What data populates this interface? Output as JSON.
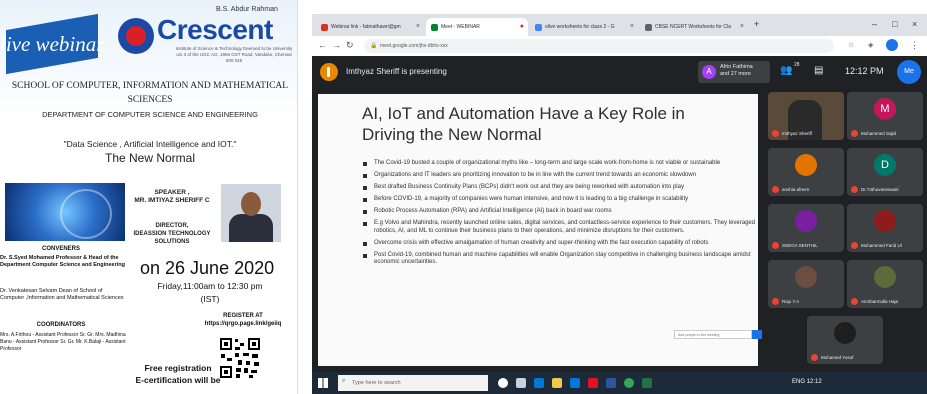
{
  "poster": {
    "live_badge": "live webinar",
    "logo_top": "B.S. Abdur Rahman",
    "logo_name": "Crescent",
    "logo_sub": "Institute of Science & Technology Deemed to be University u/s 3 of the UGC Act, 1956 GST Road, Vandalur, Chennai 600 048",
    "school": "SCHOOL OF COMPUTER, INFORMATION AND MATHEMATICAL SCIENCES",
    "department": "DEPARTMENT OF COMPUTER SCIENCE AND ENGINEERING",
    "topic": "\"Data Science , Artificial Intelligence and IOT.\"",
    "subtitle": "The New Normal",
    "speaker_heading": "SPEAKER ,",
    "speaker_name": "MR. IMTIYAZ SHERIFF C",
    "speaker_role": "DIRECTOR,",
    "speaker_company": "IDEASSION TECHNOLOGY SOLUTIONS",
    "conveners_title": "CONVENERS",
    "convener_1": "Dr. S.Syed Mohamed Professor & Head of the Department Computer Science and Engineering",
    "convener_2": "Dr. Venkatesan Selvam Dean of School of Computer ,Information and Mathematical Sciences",
    "coordinators_title": "COORDINATORS",
    "coordinators": "Mrs. A.Firthou - Assistant Professor Sr. Gr. Mrs. Madhina Banu - Assistant Professor Sr. Gr. Mr. K.Balaji - Assistant Professor",
    "date": "on 26 June 2020",
    "time_line": "Friday,11:00am to 12:30 pm",
    "timezone": "(IST)",
    "register_title": "REGISTER AT",
    "register_url": "https://qrgo.page.link/geiiq",
    "free_registration": "Free registration",
    "ecert": "E-certification will be"
  },
  "browser": {
    "tabs": [
      {
        "label": "Webinar link - fatmathawri@gm",
        "color": "#d93025"
      },
      {
        "label": "Meet - WEBINAR",
        "color": "#00832d"
      },
      {
        "label": "olive worksheets for class 2 - G",
        "color": "#4285f4"
      },
      {
        "label": "CBSE NCERT Worksheets for Cla",
        "color": "#5f6368"
      }
    ],
    "new_tab": "+",
    "window_controls": [
      "–",
      "□",
      "×"
    ],
    "url": "meet.google.com/jhs-dbhs-xsx"
  },
  "meet": {
    "presenting_text": "Imthyaz Sheriff is presenting",
    "presenter_chip_initial": "A",
    "presenter_chip_name": "Afrin Fathima",
    "presenter_chip_sub": "and 27 more",
    "people_count": "28",
    "clock": "12:12 PM",
    "self_initial": "Me",
    "slide": {
      "title": "AI, IoT and Automation Have a Key Role in Driving the New Normal",
      "bullets": [
        "The Covid-19 busted a couple of organizational myths like – long-term and large scale work-from-home is not viable or sustainable",
        "Organizations and IT leaders are prioritizing innovation to be in line with the current trend towards an economic slowdown",
        "Best drafted Business Continuity Plans (BCPs) didn't work out and they are being reworked with automation into play",
        "Before COVID-19, a majority of companies were human intensive, and now it is leading to a big challenge in scalability",
        "Robotic Process Automation (RPA) and Artificial Intelligence (AI) back in board war rooms",
        "E.g Volvo and Mahindra, recently launched online sales, digital services, and contactless-service experience to their customers. They leveraged robotics, AI, and ML to continue their business plans to their operations, and minimize disruptions for their customers.",
        "Overcome crisis with effective amalgamation of human creativity and super-thinking with the fast execution capability of robots",
        "Post Covid-19, combined human and machine capabilities will enable Organization stay competitive in challenging business landscape amidst economic uncertainties."
      ],
      "popup_text": "Add people to this meeting"
    },
    "participants": [
      {
        "name": "Imthyaz Sheriff",
        "initial": "",
        "color": "#5a4a3a",
        "video": true
      },
      {
        "name": "Mohammed Sajid",
        "initial": "M",
        "color": "#c2185b",
        "video": false
      },
      {
        "name": "anshia afreen",
        "initial": "",
        "color": "#e37400",
        "video": false
      },
      {
        "name": "Dr.T.Bhuvaneswari",
        "initial": "D",
        "color": "#00796b",
        "video": false
      },
      {
        "name": "SNEGA SENTHIL",
        "initial": "",
        "color": "#7b1fa2",
        "video": false
      },
      {
        "name": "Mohammed Farid Ul",
        "initial": "",
        "color": "#8e1c1c",
        "video": false
      },
      {
        "name": "Raju Y.A",
        "initial": "",
        "color": "#6d4c41",
        "video": false
      },
      {
        "name": "Amirbarmulla Haja",
        "initial": "",
        "color": "#5d6b3a",
        "video": false
      },
      {
        "name": "Mohamed Yusuf",
        "initial": "",
        "color": "#1e1e1e",
        "video": false
      }
    ]
  },
  "taskbar": {
    "search_placeholder": "Type here to search",
    "tray": "ENG 12:12"
  },
  "colors": {
    "meet_dark": "#202124",
    "accent_blue": "#1a73e8",
    "poster_blue": "#1a4aa5",
    "logo_red": "#d92027"
  }
}
